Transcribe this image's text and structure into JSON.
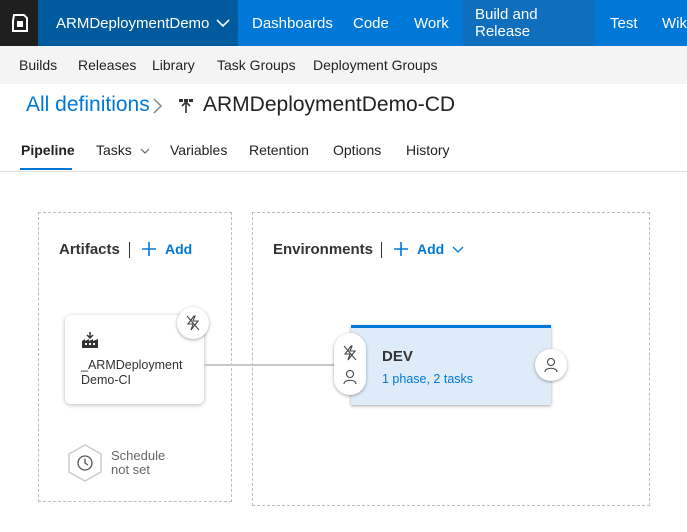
{
  "topbar": {
    "project": "ARMDeploymentDemo",
    "nav": [
      "Dashboards",
      "Code",
      "Work",
      "Build and Release",
      "Test",
      "Wik"
    ]
  },
  "subnav": [
    "Builds",
    "Releases",
    "Library",
    "Task Groups",
    "Deployment Groups"
  ],
  "breadcrumb": {
    "all": "All definitions",
    "title": "ARMDeploymentDemo-CD"
  },
  "tabs": [
    "Pipeline",
    "Tasks",
    "Variables",
    "Retention",
    "Options",
    "History"
  ],
  "artifacts": {
    "title": "Artifacts",
    "add": "Add",
    "card_line1": "_ARMDeployment",
    "card_line2": "Demo-CI",
    "schedule_line1": "Schedule",
    "schedule_line2": "not set"
  },
  "environments": {
    "title": "Environments",
    "add": "Add",
    "env_name": "DEV",
    "env_summary": "1 phase, 2 tasks"
  },
  "colors": {
    "accent": "#0078d7",
    "topbar": "#0078d7",
    "project_bg": "#005a9e",
    "active_nav": "#106ebe",
    "env_bg": "#deecf9"
  }
}
